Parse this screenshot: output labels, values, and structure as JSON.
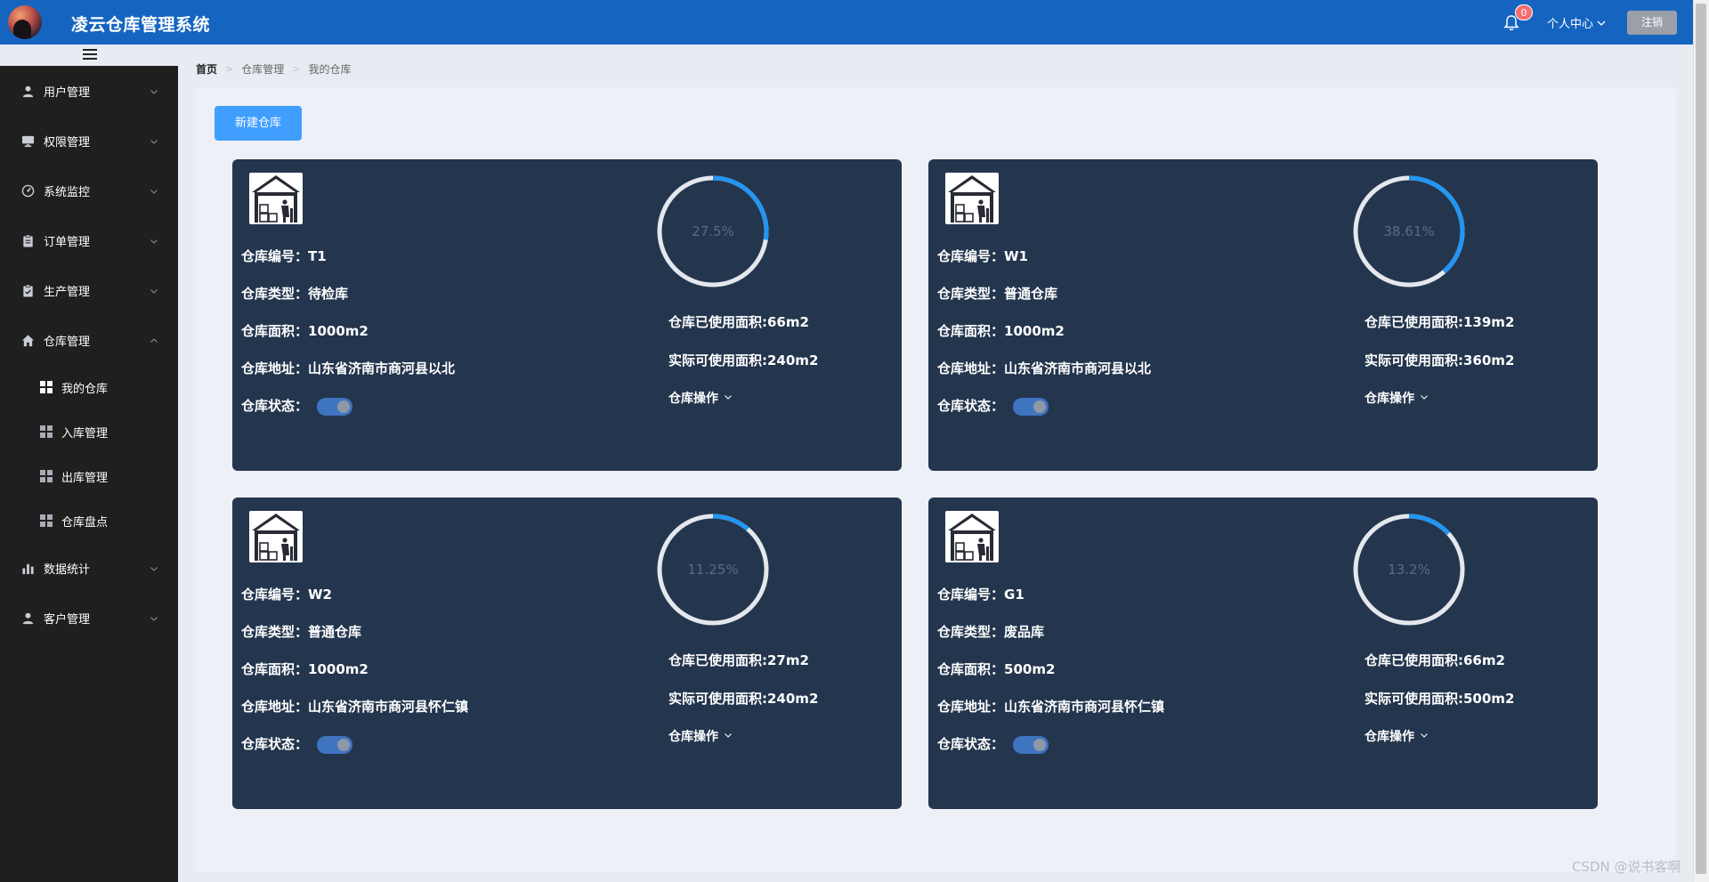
{
  "header": {
    "app_title": "凌云仓库管理系统",
    "notification_count": "0",
    "user_center_label": "个人中心",
    "logout_label": "注销"
  },
  "sidebar": {
    "items": [
      {
        "label": "用户管理",
        "icon": "user-icon"
      },
      {
        "label": "权限管理",
        "icon": "monitor-icon"
      },
      {
        "label": "系统监控",
        "icon": "gauge-icon"
      },
      {
        "label": "订单管理",
        "icon": "clipboard-icon"
      },
      {
        "label": "生产管理",
        "icon": "clipboard-check-icon"
      },
      {
        "label": "仓库管理",
        "icon": "home-icon",
        "expanded": true
      },
      {
        "label": "数据统计",
        "icon": "bar-chart-icon"
      },
      {
        "label": "客户管理",
        "icon": "user-icon"
      }
    ],
    "warehouse_sub_items": [
      {
        "label": "我的仓库",
        "active": true
      },
      {
        "label": "入库管理"
      },
      {
        "label": "出库管理"
      },
      {
        "label": "仓库盘点"
      }
    ]
  },
  "breadcrumb": [
    "首页",
    "仓库管理",
    "我的仓库"
  ],
  "toolbar": {
    "new_warehouse_label": "新建仓库"
  },
  "labels": {
    "code": "仓库编号：",
    "type": "仓库类型：",
    "area": "仓库面积：",
    "address": "仓库地址：",
    "status": "仓库状态：",
    "used_area": "仓库已使用面积:",
    "available_area": "实际可使用面积:",
    "operations": "仓库操作"
  },
  "warehouses": [
    {
      "code": "T1",
      "type": "待检库",
      "area": "1000m2",
      "address": "山东省济南市商河县以北",
      "status_on": true,
      "usage_percent": 27.5,
      "usage_label": "27.5%",
      "used_area": "66m2",
      "available_area": "240m2"
    },
    {
      "code": "W1",
      "type": "普通仓库",
      "area": "1000m2",
      "address": "山东省济南市商河县以北",
      "status_on": true,
      "usage_percent": 38.61,
      "usage_label": "38.61%",
      "used_area": "139m2",
      "available_area": "360m2"
    },
    {
      "code": "W2",
      "type": "普通仓库",
      "area": "1000m2",
      "address": "山东省济南市商河县怀仁镇",
      "status_on": true,
      "usage_percent": 11.25,
      "usage_label": "11.25%",
      "used_area": "27m2",
      "available_area": "240m2"
    },
    {
      "code": "G1",
      "type": "废品库",
      "area": "500m2",
      "address": "山东省济南市商河县怀仁镇",
      "status_on": true,
      "usage_percent": 13.2,
      "usage_label": "13.2%",
      "used_area": "66m2",
      "available_area": "500m2"
    }
  ],
  "colors": {
    "header": "#1565c0",
    "sidebar": "#1f1f20",
    "card": "#24364e",
    "accent": "#409eff",
    "ring_progress": "#2196f3",
    "ring_track": "#e4e7ed"
  },
  "watermark": "CSDN @说书客啊"
}
